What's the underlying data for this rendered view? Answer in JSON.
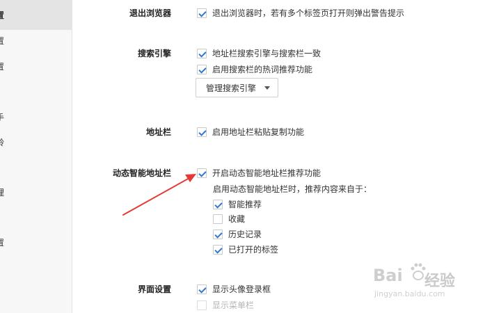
{
  "sidebar": {
    "items": [
      {
        "label": "置",
        "active": true
      },
      {
        "label": "置",
        "active": false
      },
      {
        "label": "置",
        "active": false
      },
      {
        "label": "手",
        "active": false
      },
      {
        "label": "铃",
        "active": false
      },
      {
        "label": "理",
        "active": false
      },
      {
        "label": "理",
        "active": false
      },
      {
        "label": "置",
        "active": false
      }
    ]
  },
  "sections": {
    "exit_browser": {
      "label": "退出浏览器",
      "options": [
        {
          "label": "退出浏览器时，若有多个标签页打开则弹出警告提示",
          "checked": true
        }
      ]
    },
    "search_engine": {
      "label": "搜索引擎",
      "options": [
        {
          "label": "地址栏搜索引擎与搜索栏一致",
          "checked": true
        },
        {
          "label": "启用搜索栏的热词推荐功能",
          "checked": true
        }
      ],
      "manage_button": "管理搜索引擎"
    },
    "address_bar": {
      "label": "地址栏",
      "options": [
        {
          "label": "启用地址栏粘贴复制功能",
          "checked": true
        }
      ]
    },
    "smart_address_bar": {
      "label": "动态智能地址栏",
      "main_option": {
        "label": "开启动态智能地址栏推荐功能",
        "checked": true
      },
      "note": "启用动态智能地址栏时，推荐内容来自于：",
      "sub_options": [
        {
          "label": "智能推荐",
          "checked": true
        },
        {
          "label": "收藏",
          "checked": false
        },
        {
          "label": "历史记录",
          "checked": true
        },
        {
          "label": "已打开的标签",
          "checked": true
        }
      ]
    },
    "interface": {
      "label": "界面设置",
      "options": [
        {
          "label": "显示头像登录框",
          "checked": true
        },
        {
          "label": "显示菜单栏",
          "checked": false
        }
      ]
    }
  },
  "annotation": {
    "color": "#e53935"
  },
  "watermark": {
    "logo": "Bai",
    "text": "经验",
    "url": "jingyan.baidu.com"
  }
}
